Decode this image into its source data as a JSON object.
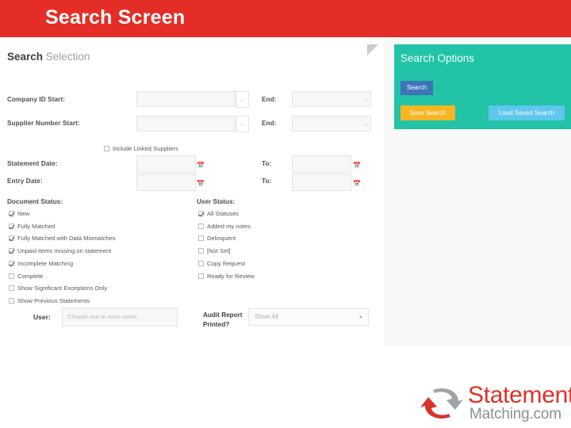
{
  "slide": {
    "title": "Search Screen"
  },
  "panel": {
    "heading_strong": "Search",
    "heading_light": "Selection",
    "fields": {
      "company_id_start_label": "Company ID Start:",
      "company_id_end_label": "End:",
      "supplier_number_start_label": "Supplier Number Start:",
      "supplier_number_end_label": "End:",
      "include_linked_suppliers_label": "Include Linked Suppliers",
      "statement_date_label": "Statement Date:",
      "statement_date_to_label": "To:",
      "entry_date_label": "Entry Date:",
      "entry_date_to_label": "To:",
      "company_id_start_value": "",
      "company_id_end_value": "",
      "supplier_number_start_value": "",
      "supplier_number_end_value": "",
      "statement_date_value": "",
      "statement_date_to_value": "",
      "entry_date_value": "",
      "entry_date_to_value": "",
      "lookup_addon_label": "...",
      "calendar_icon": "calendar-icon"
    },
    "document_status": {
      "title": "Document Status:",
      "items": [
        {
          "label": "New",
          "checked": true
        },
        {
          "label": "Fully Matched",
          "checked": true
        },
        {
          "label": "Fully Matched with Data Mismatches",
          "checked": true
        },
        {
          "label": "Unpaid items missing on statement",
          "checked": true
        },
        {
          "label": "Incomplete Matching",
          "checked": true
        },
        {
          "label": "Complete",
          "checked": false
        },
        {
          "label": "Show Significant Exceptions Only",
          "checked": false
        },
        {
          "label": "Show Previous Statements",
          "checked": false
        }
      ]
    },
    "user_status": {
      "title": "User Status:",
      "items": [
        {
          "label": "All Statuses",
          "checked": true
        },
        {
          "label": "Added my notes",
          "checked": false
        },
        {
          "label": "Delinquent",
          "checked": false
        },
        {
          "label": "[Not Set]",
          "checked": false
        },
        {
          "label": "Copy Request",
          "checked": false
        },
        {
          "label": "Ready for Review",
          "checked": false
        }
      ]
    },
    "user_row": {
      "user_label": "User:",
      "user_placeholder": "Choose one or more users",
      "audit_label": "Audit Report Printed?",
      "audit_value": "Show All"
    }
  },
  "search_options": {
    "title": "Search Options",
    "search_button": "Search",
    "save_search_button": "Save Search",
    "load_saved_search_button": "Load Saved Search",
    "colors": {
      "panel": "#22c3a6",
      "search": "#3e74b8",
      "save": "#f5b622",
      "load": "#5ec7ed"
    }
  },
  "logo": {
    "word_top": "Statement",
    "word_bottom": "Matching.com",
    "color_top": "#e03127",
    "color_bottom": "#8a8f93"
  },
  "theme": {
    "title_bar": "#e32d26",
    "panel_bg": "#ffffff",
    "backdrop": "#f7f8f8"
  }
}
